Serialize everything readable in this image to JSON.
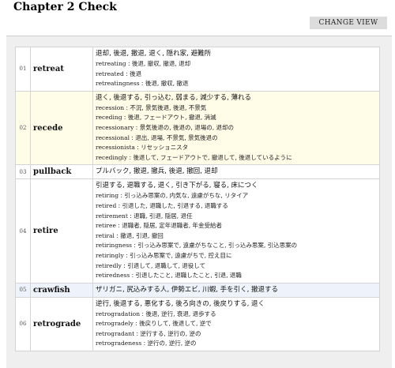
{
  "header": {
    "title": "Chapter 2 Check",
    "change_view_label": "CHANGE VIEW"
  },
  "entries": [
    {
      "num": "01",
      "word": "retreat",
      "main": "退却, 後退, 撤退, 退く, 隠れ家, 避難所",
      "derivs": [
        {
          "w": "retreating",
          "m": "後退, 撤収, 撤退, 退却"
        },
        {
          "w": "retreated",
          "m": "後退"
        },
        {
          "w": "retreatingness",
          "m": "後退, 撤収, 撤退"
        }
      ]
    },
    {
      "num": "02",
      "word": "recede",
      "main": "退く, 後退する, 引っ込む, 弱まる, 減少する, 薄れる",
      "derivs": [
        {
          "w": "recession",
          "m": "不況, 景気後退, 後退, 不景気"
        },
        {
          "w": "receding",
          "m": "後退, フェードアウト, 撤退, 消滅"
        },
        {
          "w": "recessionary",
          "m": "景気後退の, 後退の, 退場の, 退却の"
        },
        {
          "w": "recessional",
          "m": "退出, 退場, 不景気, 景気後退の"
        },
        {
          "w": "recessionista",
          "m": "リセッショニスタ"
        },
        {
          "w": "recedingly",
          "m": "後退して, フェードアウトで, 撤退して, 後退しているように"
        }
      ]
    },
    {
      "num": "03",
      "word": "pullback",
      "main": "プルバック, 撤退, 撤兵, 後退, 撤回, 退却",
      "derivs": []
    },
    {
      "num": "04",
      "word": "retire",
      "main": "引退する, 退職する, 退く, 引き下がる, 寝る, 床につく",
      "derivs": [
        {
          "w": "retiring",
          "m": "引っ込み思案の, 内気な, 遠慮がちな, リタイア"
        },
        {
          "w": "retired",
          "m": "引退した, 退職した, 引退する, 退職する"
        },
        {
          "w": "retirement",
          "m": "退職, 引退, 隠居, 退任"
        },
        {
          "w": "retiree",
          "m": "退職者, 隠居, 定年退職者, 年金受給者"
        },
        {
          "w": "retiral",
          "m": "撤退, 引退, 撤回"
        },
        {
          "w": "retiringness",
          "m": "引っ込み思案で, 遠慮がちなこと, 引っ込み思案, 引込思案の"
        },
        {
          "w": "retiringly",
          "m": "引っ込み思案で, 遠慮がちで, 控え目に"
        },
        {
          "w": "retiredly",
          "m": "引退して, 退職して, 退役して"
        },
        {
          "w": "retiredness",
          "m": "引退したこと, 退職したこと, 引退, 退職"
        }
      ]
    },
    {
      "num": "05",
      "word": "crawfish",
      "main": "ザリガニ, 尻込みする人, 伊勢エビ, 川蝦, 手を引く, 撤退する",
      "derivs": []
    },
    {
      "num": "06",
      "word": "retrograde",
      "main": "逆行, 後退する, 悪化する, 後ろ向きの, 後戻りする, 退く",
      "derivs": [
        {
          "w": "retrogradation",
          "m": "後退, 逆行, 衰退, 退歩する"
        },
        {
          "w": "retrogradely",
          "m": "後戻りして, 後退して, 逆で"
        },
        {
          "w": "retrogradant",
          "m": "逆行する, 逆行の, 逆の"
        },
        {
          "w": "retrogradeness",
          "m": "逆行の, 逆行, 逆の"
        }
      ]
    }
  ]
}
